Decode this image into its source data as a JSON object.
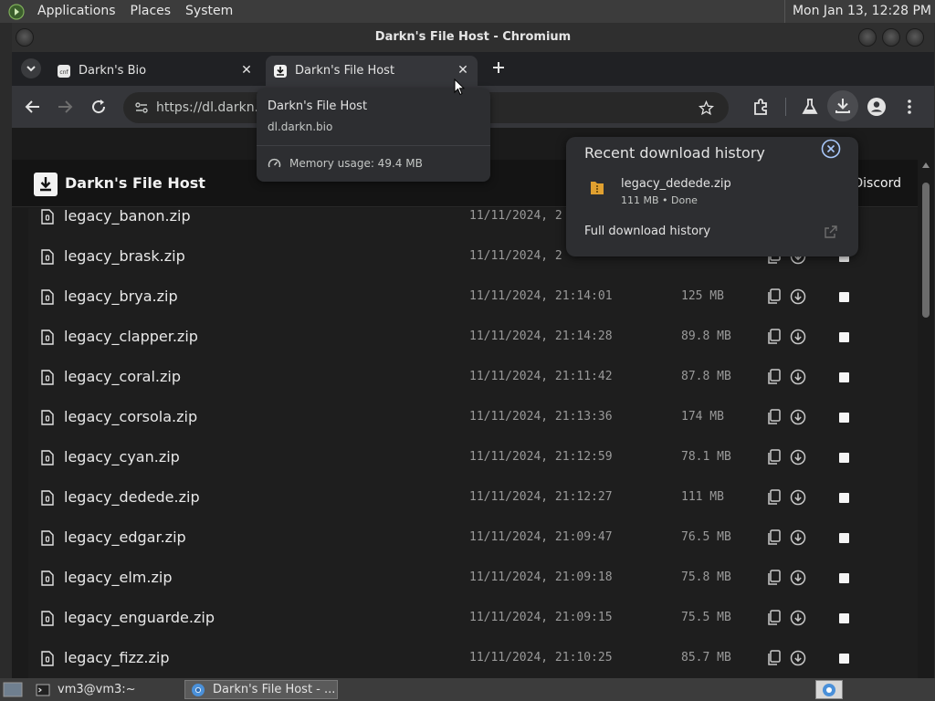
{
  "top_panel": {
    "menus": [
      "Applications",
      "Places",
      "System"
    ],
    "clock": "Mon Jan 13, 12:28 PM"
  },
  "window": {
    "title": "Darkn's File Host - Chromium"
  },
  "tabs": [
    {
      "label": "Darkn's Bio",
      "active": false
    },
    {
      "label": "Darkn's File Host",
      "active": true
    }
  ],
  "toolbar": {
    "url": "https://dl.darkn.b"
  },
  "hover_card": {
    "title": "Darkn's File Host",
    "domain": "dl.darkn.bio",
    "memory": "Memory usage: 49.4 MB"
  },
  "download_bubble": {
    "heading": "Recent download history",
    "item_name": "legacy_dedede.zip",
    "item_meta": "111 MB • Done",
    "full_history": "Full download history"
  },
  "site": {
    "title": "Darkn's File Host",
    "nav_discord": "Discord"
  },
  "files": [
    {
      "name": "legacy_banon.zip",
      "date": "11/11/2024, 2",
      "size": ""
    },
    {
      "name": "legacy_brask.zip",
      "date": "11/11/2024, 2",
      "size": ""
    },
    {
      "name": "legacy_brya.zip",
      "date": "11/11/2024, 21:14:01",
      "size": "125 MB"
    },
    {
      "name": "legacy_clapper.zip",
      "date": "11/11/2024, 21:14:28",
      "size": "89.8 MB"
    },
    {
      "name": "legacy_coral.zip",
      "date": "11/11/2024, 21:11:42",
      "size": "87.8 MB"
    },
    {
      "name": "legacy_corsola.zip",
      "date": "11/11/2024, 21:13:36",
      "size": "174 MB"
    },
    {
      "name": "legacy_cyan.zip",
      "date": "11/11/2024, 21:12:59",
      "size": "78.1 MB"
    },
    {
      "name": "legacy_dedede.zip",
      "date": "11/11/2024, 21:12:27",
      "size": "111 MB"
    },
    {
      "name": "legacy_edgar.zip",
      "date": "11/11/2024, 21:09:47",
      "size": "76.5 MB"
    },
    {
      "name": "legacy_elm.zip",
      "date": "11/11/2024, 21:09:18",
      "size": "75.8 MB"
    },
    {
      "name": "legacy_enguarde.zip",
      "date": "11/11/2024, 21:09:15",
      "size": "75.5 MB"
    },
    {
      "name": "legacy_fizz.zip",
      "date": "11/11/2024, 21:10:25",
      "size": "85.7 MB"
    }
  ],
  "taskbar": {
    "items": [
      "vm3@vm3:~",
      "Darkn's File Host - ..."
    ]
  }
}
